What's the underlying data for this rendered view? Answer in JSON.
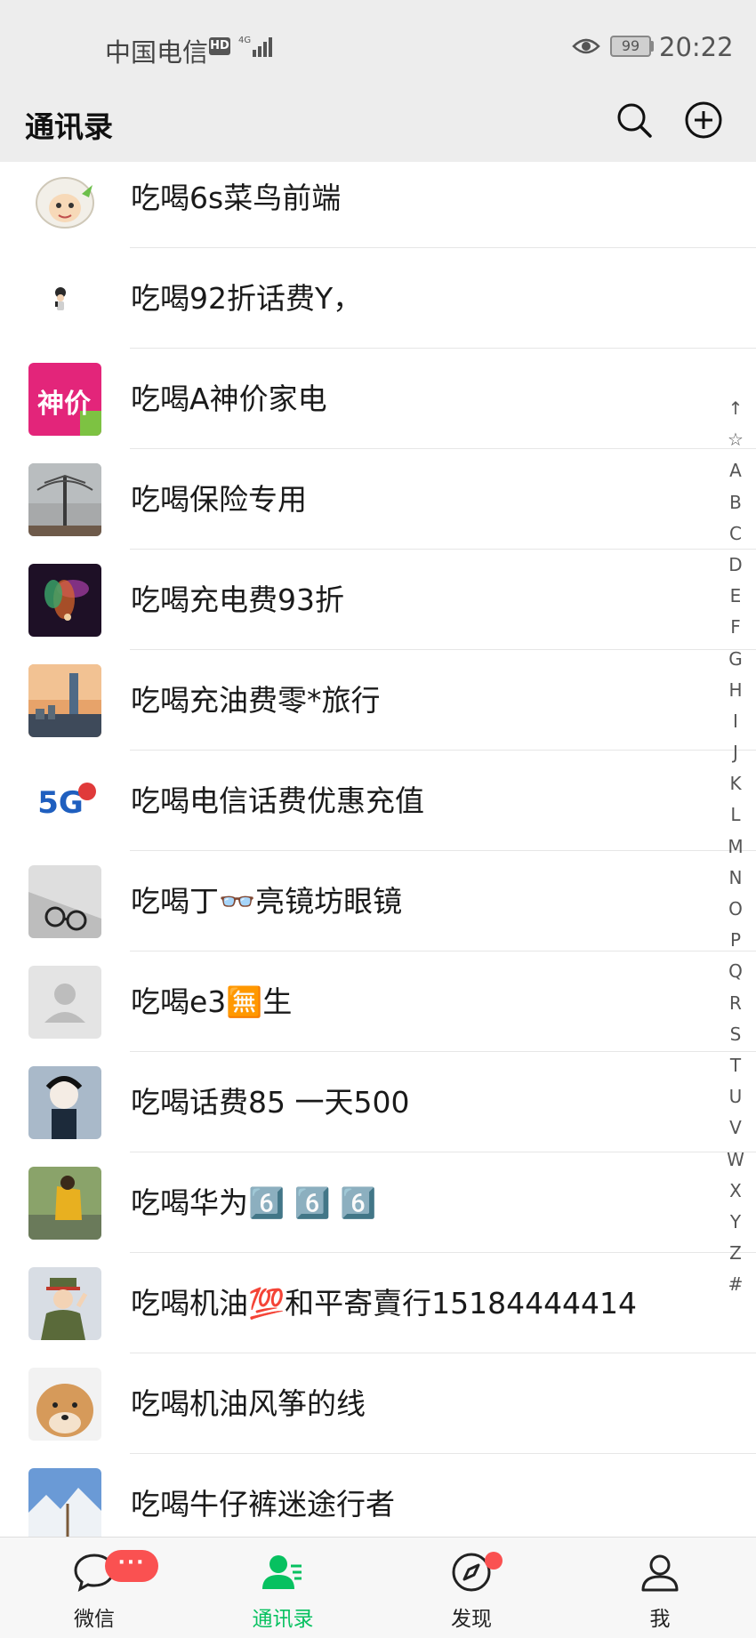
{
  "status_bar": {
    "carrier": "中国电信",
    "hd": "HD",
    "network": "4G",
    "battery": "99",
    "time": "20:22"
  },
  "header": {
    "title": "通讯录"
  },
  "contacts": [
    {
      "name": "吃喝6s菜鸟前端"
    },
    {
      "name": "吃喝92折话费Y，"
    },
    {
      "name": "吃喝A神价家电",
      "avatar_text": "神价"
    },
    {
      "name": "吃喝保险专用"
    },
    {
      "name": "吃喝充电费93折"
    },
    {
      "name": "吃喝充油费零*旅行"
    },
    {
      "name": "吃喝电信话费优惠充值",
      "avatar_text": "5G"
    },
    {
      "name": "吃喝丁👓亮镜坊眼镜"
    },
    {
      "name": "吃喝e3🈚生"
    },
    {
      "name": "吃喝话费85 一天500"
    },
    {
      "name": "吃喝华为6️⃣ 6️⃣ 6️⃣"
    },
    {
      "name": "吃喝机油💯和平寄賣行15184444414"
    },
    {
      "name": "吃喝机油风筝的线"
    },
    {
      "name": "吃喝牛仔裤迷途行者"
    }
  ],
  "index": [
    "↑",
    "☆",
    "A",
    "B",
    "C",
    "D",
    "E",
    "F",
    "G",
    "H",
    "I",
    "J",
    "K",
    "L",
    "M",
    "N",
    "O",
    "P",
    "Q",
    "R",
    "S",
    "T",
    "U",
    "V",
    "W",
    "X",
    "Y",
    "Z",
    "#"
  ],
  "tabs": [
    {
      "label": "微信",
      "badge": "···"
    },
    {
      "label": "通讯录"
    },
    {
      "label": "发现"
    },
    {
      "label": "我"
    }
  ],
  "colors": {
    "accent": "#07c160",
    "badge": "#fa5151",
    "header_bg": "#ededed"
  }
}
